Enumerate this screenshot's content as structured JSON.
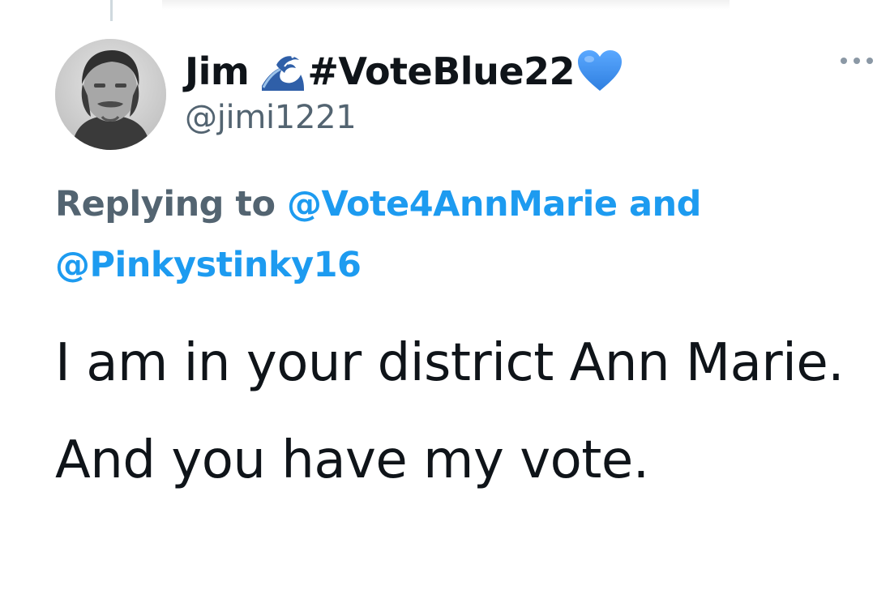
{
  "tweet": {
    "author": {
      "display_name": "Jim",
      "name_emoji_icon": "wave-icon",
      "hashtag": "#VoteBlue22",
      "trailing_emoji_icon": "blue-heart-icon",
      "handle": "@jimi1221"
    },
    "replying_to": {
      "prefix": "Replying to",
      "mentions": [
        "@Vote4AnnMarie",
        "@Pinkystinky16"
      ],
      "joiner": "and"
    },
    "body_text": "I am in your district Ann Marie. And you have my vote.",
    "more_icon": "more-options-icon"
  },
  "colors": {
    "mention_blue": "#1d9bf0",
    "secondary_gray": "#536471",
    "text_primary": "#0f1419",
    "heart_blue": "#3b8ff0"
  }
}
